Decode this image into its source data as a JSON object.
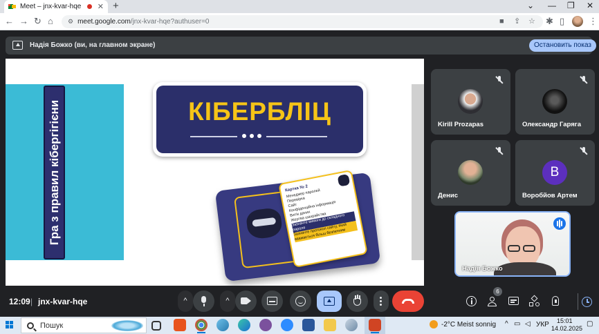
{
  "browser": {
    "tab_title": "Meet – jnx-kvar-hqe",
    "tab_close": "✕",
    "new_tab": "+",
    "window_controls": {
      "chevron": "⌄",
      "minimize": "—",
      "restore": "❐",
      "close": "✕"
    },
    "url_host": "meet.google.com",
    "url_path": "/jnx-kvar-hqe?authuser=0",
    "nav": {
      "back": "←",
      "forward": "→",
      "reload": "↻",
      "home": "⌂",
      "lock": "⚙",
      "bookmark": "☆",
      "extensions": "⋮"
    }
  },
  "banner": {
    "presenting_label": "Надія Божко (ви, на главном экране)",
    "stop_button": "Остановить показ"
  },
  "slide": {
    "vertical_title": "Гра з правил кібергігієни",
    "main_title": "КІБЕРБЛІЦ",
    "card_title": "Картка № 2",
    "card_items": [
      {
        "text": "Менеджер паролей",
        "style": ""
      },
      {
        "text": "Перевірка",
        "style": ""
      },
      {
        "text": "Сайт",
        "style": ""
      },
      {
        "text": "Конфіденційна інформація",
        "style": ""
      },
      {
        "text": "Витік даних",
        "style": ""
      },
      {
        "text": "Жертва шахрайства",
        "style": ""
      },
      {
        "text": "Зазначте вимоги до складного пароля",
        "style": "hl"
      },
      {
        "text": "Зазначте протокол сайту, який вважається більш безпечним",
        "style": "hy"
      }
    ]
  },
  "participants": [
    {
      "name": "Kirill Prozapas",
      "avatar": "photo"
    },
    {
      "name": "Олександр Гаряга",
      "avatar": "photo"
    },
    {
      "name": "Денис",
      "avatar": "photo"
    },
    {
      "name": "Воробйов Артем",
      "avatar": "В"
    }
  ],
  "self_view": {
    "name": "Надія Божко"
  },
  "bottom_bar": {
    "time": "12:09",
    "separator": "|",
    "meeting_code": "jnx-kvar-hqe",
    "chevron": "^",
    "people_count": "6"
  },
  "taskbar": {
    "search_placeholder": "Пошук",
    "weather": "-2°C  Meist sonnig",
    "language": "УКР",
    "time": "15:01",
    "date": "14.02.2025"
  },
  "colors": {
    "meet_bg": "#202124",
    "tile_bg": "#3c4043",
    "accent": "#a8c7fa",
    "end_call": "#ea4335",
    "slide_navy": "#2b2f6a",
    "slide_yellow": "#f6c417",
    "slide_cyan": "#3bbbd6"
  }
}
